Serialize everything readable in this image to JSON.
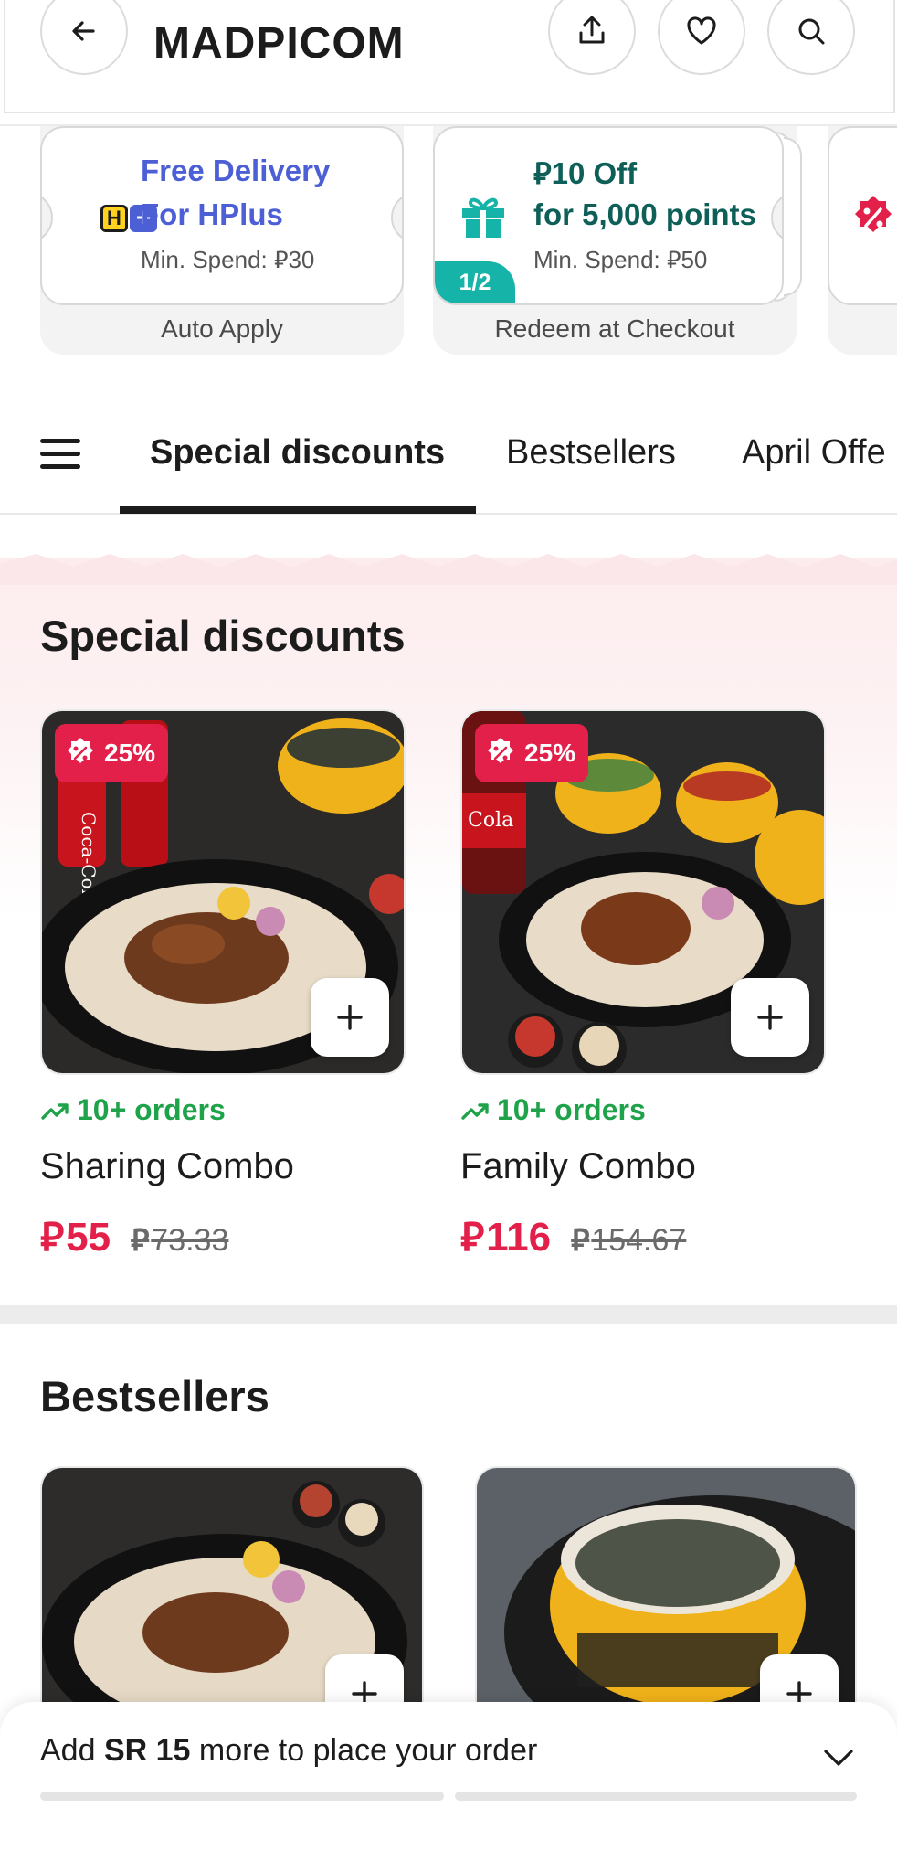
{
  "header": {
    "title": "MADPICOM",
    "back_icon": "arrow-left-icon",
    "share_icon": "share-icon",
    "favorite_icon": "heart-icon",
    "search_icon": "search-icon"
  },
  "offers": [
    {
      "line1": "Free Delivery",
      "line2": "For HPlus",
      "min_spend_label": "Min. Spend:",
      "min_spend_value": "30",
      "footer": "Auto Apply",
      "badge_h": "H",
      "badge_plus": "+",
      "accent": "#4c5fd5"
    },
    {
      "line1_value": "10 Off",
      "line2": "for 5,000 points",
      "min_spend_label": "Min. Spend:",
      "min_spend_value": "50",
      "footer": "Redeem at Checkout",
      "pager": "1/2",
      "accent": "#0f5f59"
    }
  ],
  "tabs": [
    "Special discounts",
    "Bestsellers",
    "April Offe"
  ],
  "special": {
    "title": "Special discounts",
    "items": [
      {
        "discount": "25%",
        "orders": "10+ orders",
        "name": "Sharing Combo",
        "price": "55",
        "old_price": "73.33"
      },
      {
        "discount": "25%",
        "orders": "10+ orders",
        "name": "Family Combo",
        "price": "116",
        "old_price": "154.67"
      }
    ]
  },
  "bestsellers": {
    "title": "Bestsellers"
  },
  "bottom_bar": {
    "prefix": "Add ",
    "amount": "SR 15",
    "suffix": " more to place your order"
  },
  "currency_symbol": "⃁",
  "colors": {
    "discount_red": "#e2204a",
    "orders_green": "#1ea34a",
    "hplus_blue": "#4c5fd5",
    "teal": "#16b3a8"
  }
}
